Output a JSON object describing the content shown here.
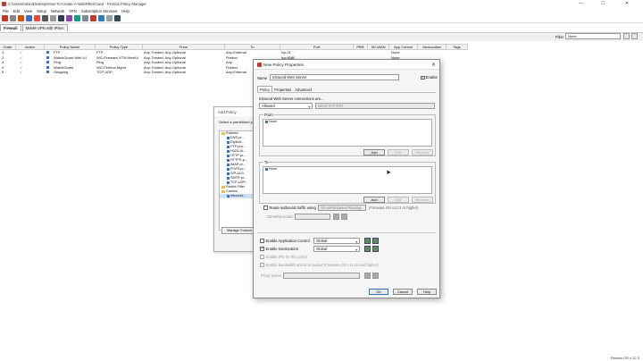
{
  "app": {
    "title": "C:\\Users\\rohin\\Desktop\\How-To-Create-A-WebFilter\\Carol - Firebox Policy Manager",
    "version": "Firebox OS v 12.3"
  },
  "menubar": [
    "File",
    "Edit",
    "View",
    "Setup",
    "Network",
    "VPN",
    "Subscription Services",
    "Help"
  ],
  "tabs": [
    {
      "label": "Firewall",
      "active": true
    },
    {
      "label": "Mobile VPN with IPSec",
      "active": false
    }
  ],
  "filter": {
    "label": "Filter",
    "value": "None"
  },
  "table": {
    "headers": [
      "Order",
      "Action",
      "Policy Name",
      "Policy Type",
      "From",
      "To",
      "Port",
      "PBR",
      "SD-WAN",
      "App Control",
      "Geolocation",
      "Tags"
    ],
    "rows": [
      {
        "order": "1",
        "name": "FTP",
        "type": "FTP",
        "from": "Any-Trusted, Any-Optional",
        "to": "Any-External",
        "port": "tcp:21",
        "geo": "None"
      },
      {
        "order": "2",
        "name": "WatchGuard Web UI",
        "type": "WG-Fireware-XTM-WebUI",
        "from": "Any-Trusted, Any-Optional",
        "to": "Firebox",
        "port": "tcp:8080",
        "geo": "None"
      },
      {
        "order": "3",
        "name": "Ping",
        "type": "Ping",
        "from": "Any-Trusted, Any-Optional",
        "to": "Any",
        "port": "ICMP (type: 8...",
        "geo": "None"
      },
      {
        "order": "4",
        "name": "WatchGuard",
        "type": "WG-Firebox-Mgmt",
        "from": "Any-Trusted, Any-Optional",
        "to": "Firebox",
        "port": "tcp:4105 tcp:...",
        "geo": "None"
      },
      {
        "order": "5",
        "name": "Outgoing",
        "type": "TCP-UDP",
        "from": "Any-Trusted, Any-Optional",
        "to": "Any-External",
        "port": "tcp:0 (Any) u...",
        "geo": "None"
      }
    ]
  },
  "add_policy": {
    "title": "Add Policy",
    "subtitle": "Select a predefined p...",
    "tree": [
      {
        "label": "Packets",
        "kind": "folder"
      },
      {
        "label": "DNS-pr...",
        "kind": "item"
      },
      {
        "label": "Explicit...",
        "kind": "item"
      },
      {
        "label": "FTP-pro...",
        "kind": "item"
      },
      {
        "label": "H323-AL...",
        "kind": "item"
      },
      {
        "label": "HTTP-pr...",
        "kind": "item"
      },
      {
        "label": "HTTPS-p...",
        "kind": "item"
      },
      {
        "label": "IMAP-pr...",
        "kind": "item"
      },
      {
        "label": "POP3-pr...",
        "kind": "item"
      },
      {
        "label": "SIP-ALG",
        "kind": "item"
      },
      {
        "label": "SMTP-pr...",
        "kind": "item"
      },
      {
        "label": "TCP-UDP...",
        "kind": "item"
      },
      {
        "label": "Packet Filter",
        "kind": "folder"
      },
      {
        "label": "Custom",
        "kind": "folder"
      },
      {
        "label": "Inbound...",
        "kind": "item",
        "selected": true
      }
    ],
    "manage_label": "Manage Custom"
  },
  "dialog": {
    "title": "New Policy Properties",
    "name_label": "Name",
    "name_value": "Inbound Web Server",
    "enable_label": "Enable",
    "tabs": [
      "Policy",
      "Properties",
      "Advanced"
    ],
    "connections_label": "Inbound Web Server connections are...",
    "connections_value": "Allowed",
    "send_tcp_rst": "Send TCP RST",
    "from_title": "From",
    "from_items": [
      "None"
    ],
    "to_title": "To",
    "to_items": [
      "None"
    ],
    "add": "Add",
    "edit": "Edit",
    "remove": "Remove",
    "route_label": "Route outbound traffic using",
    "route_select": "SD-WAN Based Routing",
    "route_note": "(Fireware OS v12.3 or higher)",
    "sdwan_label": "SD-WAN Action",
    "app_control_label": "Enable Application Control",
    "app_control_value": "Global",
    "geolocation_label": "Enable Geolocation",
    "geolocation_value": "Global",
    "ips_label": "Enable IPS for this policy",
    "bandwidth_label": "Enable bandwidth and time quotas (Fireware OS v11.10 and higher)",
    "proxy_label": "Proxy action",
    "ok": "OK",
    "cancel": "Cancel",
    "help": "Help"
  },
  "colors": {
    "accent": "#2c6fc7",
    "check": "#117a11",
    "brand": "#c0392b"
  }
}
